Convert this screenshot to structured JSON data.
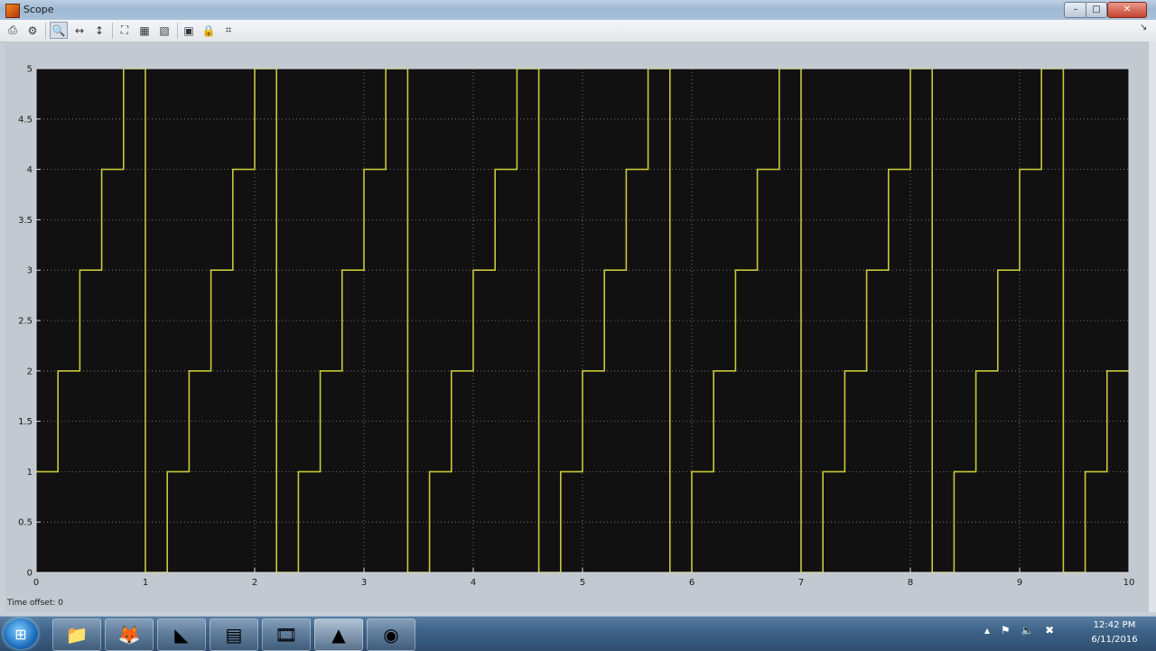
{
  "window": {
    "title": "Scope",
    "minimize_glyph": "–",
    "maximize_glyph": "□",
    "close_glyph": "✕"
  },
  "toolbar": {
    "buttons": [
      {
        "icon": "print-icon",
        "glyph": "⎙"
      },
      {
        "icon": "parameters-icon",
        "glyph": "⚙"
      },
      {
        "icon": "zoom-icon",
        "glyph": "🔍"
      },
      {
        "icon": "zoom-x-icon",
        "glyph": "↔"
      },
      {
        "icon": "zoom-y-icon",
        "glyph": "↕"
      },
      {
        "icon": "autoscale-icon",
        "glyph": "⛶"
      },
      {
        "icon": "save-axes-icon",
        "glyph": "▦"
      },
      {
        "icon": "restore-axes-icon",
        "glyph": "▧"
      },
      {
        "icon": "floating-scope-icon",
        "glyph": "▣"
      },
      {
        "icon": "lock-axes-icon",
        "glyph": "🔒"
      },
      {
        "icon": "signal-selector-icon",
        "glyph": "⌗"
      }
    ],
    "dock_glyph": "↘"
  },
  "footer": {
    "time_offset_label": "Time offset:",
    "time_offset_value": "0"
  },
  "colors": {
    "plot_background": "#111111",
    "trace": "#c8c83a",
    "grid": "#8a8a8a"
  },
  "chart_data": {
    "type": "line",
    "title": "",
    "xlabel": "",
    "ylabel": "",
    "xlim": [
      0,
      10
    ],
    "ylim": [
      0,
      5
    ],
    "xticks": [
      0,
      1,
      2,
      3,
      4,
      5,
      6,
      7,
      8,
      9,
      10
    ],
    "yticks": [
      0,
      0.5,
      1,
      1.5,
      2,
      2.5,
      3,
      3.5,
      4,
      4.5,
      5
    ],
    "grid": true,
    "step": true,
    "series": [
      {
        "x": [
          0,
          0.2,
          0.4,
          0.6,
          0.8,
          1.0,
          1.2,
          1.4,
          1.6,
          1.8,
          2.0,
          2.2,
          2.4,
          2.6,
          2.8,
          3.0,
          3.2,
          3.4,
          3.6,
          3.8,
          4.0,
          4.2,
          4.4,
          4.6,
          4.8,
          5.0,
          5.2,
          5.4,
          5.6,
          5.8,
          6.0,
          6.2,
          6.4,
          6.6,
          6.8,
          7.0,
          7.2,
          7.4,
          7.6,
          7.8,
          8.0,
          8.2,
          8.4,
          8.6,
          8.8,
          9.0,
          9.2,
          9.4,
          9.6,
          9.8,
          10.0
        ],
        "y": [
          1,
          2,
          3,
          4,
          5,
          0,
          1,
          2,
          3,
          4,
          5,
          0,
          1,
          2,
          3,
          4,
          5,
          0,
          1,
          2,
          3,
          4,
          5,
          0,
          1,
          2,
          3,
          4,
          5,
          0,
          1,
          2,
          3,
          4,
          5,
          0,
          1,
          2,
          3,
          4,
          5,
          0,
          1,
          2,
          3,
          4,
          5,
          0,
          1,
          2,
          2
        ]
      }
    ]
  },
  "taskbar": {
    "start_glyph": "⊞",
    "apps": [
      {
        "icon": "file-explorer-icon",
        "glyph": "📁"
      },
      {
        "icon": "firefox-icon",
        "glyph": "🦊"
      },
      {
        "icon": "visual-studio-icon",
        "glyph": "◣"
      },
      {
        "icon": "app-window-icon",
        "glyph": "▤"
      },
      {
        "icon": "film-icon",
        "glyph": "🎞"
      },
      {
        "icon": "matlab-icon",
        "glyph": "▲"
      },
      {
        "icon": "obs-icon",
        "glyph": "◉"
      }
    ],
    "tray_glyphs": "▴ ⚑ 🔈 ✖",
    "clock_time": "12:42 PM",
    "clock_date": "6/11/2016"
  }
}
